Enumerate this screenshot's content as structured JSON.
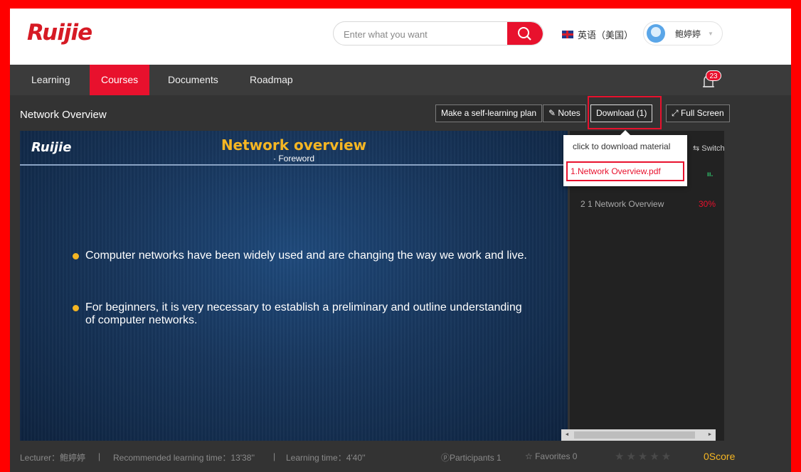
{
  "brand": {
    "logo": "Ruijie"
  },
  "search": {
    "placeholder": "Enter what you want"
  },
  "language": {
    "label": "英语（美国）"
  },
  "user": {
    "name": "鲍婷婷"
  },
  "nav": {
    "items": [
      {
        "label": "Learning",
        "active": false
      },
      {
        "label": "Courses",
        "active": true
      },
      {
        "label": "Documents",
        "active": false
      },
      {
        "label": "Roadmap",
        "active": false
      }
    ],
    "notifications": "23"
  },
  "course": {
    "title": "Network Overview",
    "buttons": {
      "plan": "Make a self-learning plan",
      "notes": "Notes",
      "download": "Download  (1)",
      "fullscreen": "Full Screen"
    }
  },
  "download_menu": {
    "title": "click to download material",
    "file": "1.Network Overview.pdf"
  },
  "slide": {
    "logo": "Ruijie",
    "title": "Network overview",
    "subtitle": "· Foreword",
    "bullet1": "Computer networks have been widely used and are changing the way we work and live.",
    "bullet2_line1": "For beginners, it is very necessary to establish a preliminary and outline understanding",
    "bullet2_line2": "of computer networks."
  },
  "panel": {
    "switch": "⇆ Switch",
    "signal": "ıı.",
    "lesson": "2   1 Network Overview",
    "lesson_progress": "30%"
  },
  "footer": {
    "lecturer": "Lecturer：鲍婷婷",
    "sep": "|",
    "recommended": "Recommended learning time：13'38''",
    "learning": "Learning time：4'40''",
    "participants": "ⓟParticipants 1",
    "favorites": "☆ Favorites 0",
    "stars": "★★★★★",
    "score": "0Score"
  },
  "colors": {
    "accent": "#e8112d",
    "gold": "#f5b623",
    "dark": "#333333"
  }
}
